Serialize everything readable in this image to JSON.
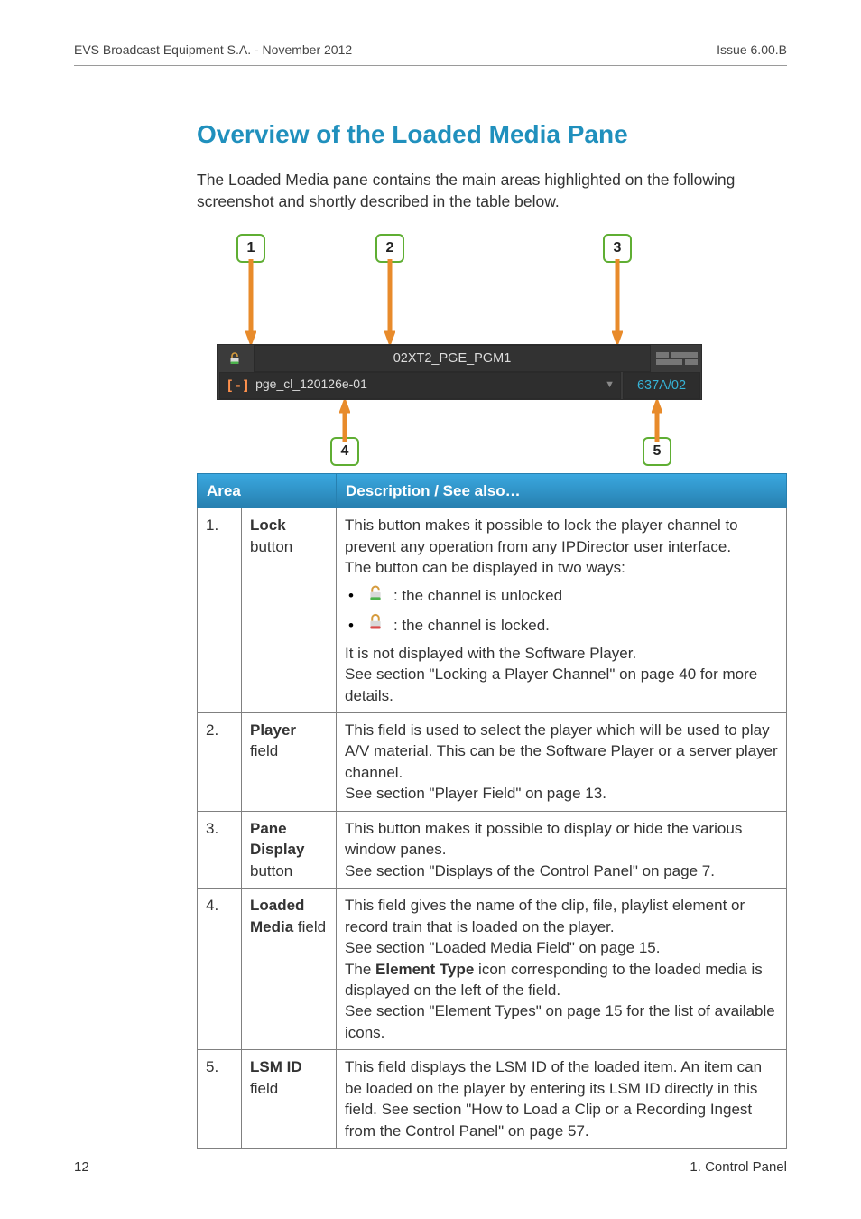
{
  "header": {
    "left": "EVS Broadcast Equipment S.A.  - November 2012",
    "right": "Issue 6.00.B"
  },
  "title": "Overview of the Loaded Media Pane",
  "lead": "The Loaded Media pane contains the main areas highlighted on the following screenshot and shortly described in the table below.",
  "screenshot": {
    "player_text": "02XT2_PGE_PGM1",
    "media_text": "pge_cl_120126e-01",
    "lsm_text": "637A/02",
    "element_type_glyph": "[-]",
    "callouts": {
      "c1": "1",
      "c2": "2",
      "c3": "3",
      "c4": "4",
      "c5": "5"
    }
  },
  "table": {
    "header_area": "Area",
    "header_desc": "Description / See also…",
    "rows": [
      {
        "n": "1.",
        "name_bold": "Lock",
        "name_rest": "button",
        "d1": "This button makes it possible to lock the player channel to prevent any operation from any IPDirector user interface.",
        "d2": "The button can be displayed in two ways:",
        "bul1": ": the channel is unlocked",
        "bul2": ": the channel is locked.",
        "d3": "It is not displayed with the Software Player.",
        "d4": "See section \"Locking a Player Channel\" on page 40 for more details."
      },
      {
        "n": "2.",
        "name_bold": "Player",
        "name_rest": "field",
        "d1": "This field is used to select the player which will be used to play A/V material. This can be the Software Player or a server player channel.",
        "d2": "See section \"Player Field\" on page 13."
      },
      {
        "n": "3.",
        "name_bold": "Pane Display",
        "name_rest": "button",
        "d1": "This button makes it possible to display or hide the various window panes.",
        "d2": "See section \"Displays of the Control Panel\" on page 7."
      },
      {
        "n": "4.",
        "name_bold": "Loaded Media",
        "name_rest": "field",
        "d1": "This field gives the name of the clip, file, playlist element or record train that is loaded on the player.",
        "d2": "See section \"Loaded Media Field\" on page 15.",
        "d3a": "The ",
        "d3b": "Element Type",
        "d3c": " icon corresponding to the loaded media is displayed on the left of the field.",
        "d4": "See section \"Element Types\" on page 15 for the list of available icons."
      },
      {
        "n": "5.",
        "name_bold": "LSM ID",
        "name_rest": "field",
        "d1": "This field displays the LSM ID of the loaded item. An item can be loaded on the player by entering its LSM ID directly in this field. See section \"How to Load a Clip or a Recording Ingest from the Control Panel\" on page 57."
      }
    ]
  },
  "footer": {
    "page": "12",
    "section": "1. Control Panel"
  }
}
